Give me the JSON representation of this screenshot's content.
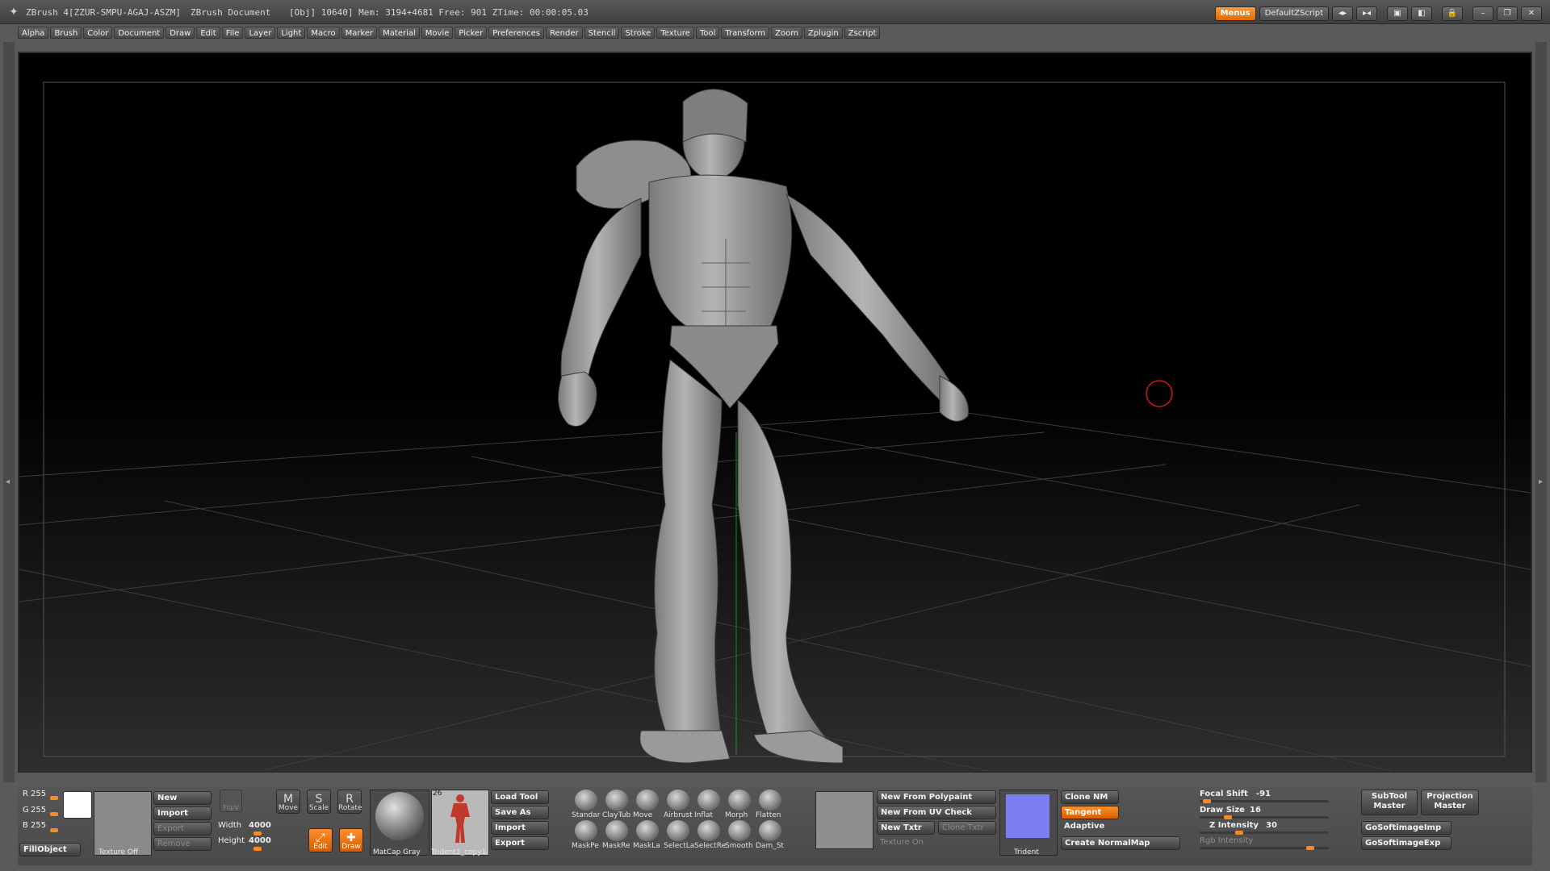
{
  "titlebar": {
    "app": "ZBrush 4[ZZUR-SMPU-AGAJ-ASZM]",
    "doc": "ZBrush Document",
    "stats": "[Obj] 10640] Mem: 3194+4681  Free: 901  ZTime: 00:00:05.03",
    "menus_button": "Menus",
    "script_button": "DefaultZScript"
  },
  "menus": [
    "Alpha",
    "Brush",
    "Color",
    "Document",
    "Draw",
    "Edit",
    "File",
    "Layer",
    "Light",
    "Macro",
    "Marker",
    "Material",
    "Movie",
    "Picker",
    "Preferences",
    "Render",
    "Stencil",
    "Stroke",
    "Texture",
    "Tool",
    "Transform",
    "Zoom",
    "Zplugin",
    "Zscript"
  ],
  "color": {
    "r_label": "R",
    "r_value": "255",
    "g_label": "G",
    "g_value": "255",
    "b_label": "B",
    "b_value": "255",
    "fill_button": "FillObject"
  },
  "texture": {
    "thumb_label": "Texture Off",
    "new": "New",
    "import": "Import",
    "export": "Export",
    "remove": "Remove",
    "width_label": "Width",
    "width_value": "4000",
    "height_label": "Height",
    "height_value": "4000",
    "flip_label": "FlipV"
  },
  "transform": {
    "move_label": "Move",
    "scale_label": "Scale",
    "rotate_label": "Rotate",
    "edit_label": "Edit",
    "draw_label": "Draw",
    "move_key": "M",
    "scale_key": "S",
    "rotate_key": "R"
  },
  "material": {
    "label": "MatCap Gray"
  },
  "tool": {
    "label": "Trident1_copy1",
    "count": "26",
    "load": "Load Tool",
    "save": "Save As",
    "import": "Import",
    "export": "Export"
  },
  "brushes": {
    "row1": [
      "Standar",
      "ClayTub",
      "Move",
      "Airbrust",
      "Inflat",
      "Morph",
      "Flatten"
    ],
    "row2": [
      "MaskPe",
      "MaskRe",
      "MaskLa",
      "SelectLa",
      "SelectRe",
      "Smooth",
      "Dam_St"
    ]
  },
  "polypaint": {
    "from_polypaint": "New From Polypaint",
    "from_uv": "New From UV Check",
    "new_txtr": "New Txtr",
    "clone_txtr": "Clone Txtr",
    "texture_on": "Texture On"
  },
  "normalmap": {
    "thumb_label": "Trident",
    "clone_nm": "Clone NM",
    "tangent": "Tangent",
    "adaptive": "Adaptive",
    "create": "Create NormalMap"
  },
  "sliders": {
    "focal_label": "Focal Shift",
    "focal_value": "-91",
    "draw_label": "Draw Size",
    "draw_value": "16",
    "z_label": "Z Intensity",
    "z_value": "30",
    "rgb_label": "Rgb Intensity"
  },
  "subtool": {
    "master": "SubTool Master",
    "projection": "Projection Master",
    "go_imp": "GoSoftimageImp",
    "go_exp": "GoSoftimageExp"
  }
}
